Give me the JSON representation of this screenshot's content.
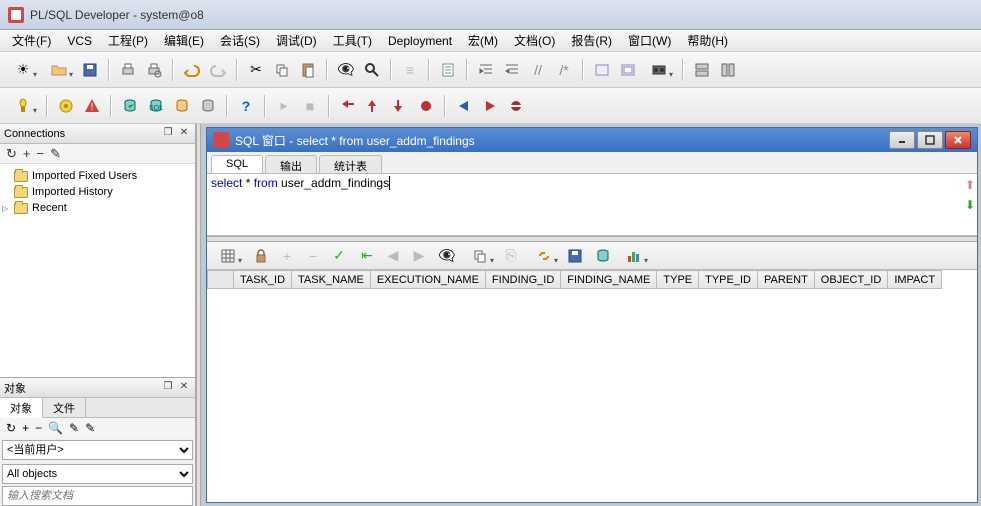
{
  "app": {
    "title": "PL/SQL Developer - system@o8"
  },
  "menu": {
    "file": "文件(F)",
    "vcs": "VCS",
    "project": "工程(P)",
    "edit": "编辑(E)",
    "session": "会话(S)",
    "debug": "调试(D)",
    "tools": "工具(T)",
    "deployment": "Deployment",
    "macro": "宏(M)",
    "document": "文档(O)",
    "report": "报告(R)",
    "window": "窗口(W)",
    "help": "帮助(H)"
  },
  "panels": {
    "connections": {
      "title": "Connections",
      "items": [
        {
          "label": "Imported Fixed Users",
          "exp": false
        },
        {
          "label": "Imported History",
          "exp": false
        },
        {
          "label": "Recent",
          "exp": true
        }
      ]
    },
    "objects": {
      "title": "对象",
      "tabs": {
        "obj": "对象",
        "file": "文件"
      },
      "user_select": "<当前用户>",
      "filter_select": "All objects",
      "search_placeholder": "输入搜索文档"
    }
  },
  "sqlwin": {
    "title": "SQL 窗口 - select * from user_addm_findings",
    "tabs": {
      "sql": "SQL",
      "output": "输出",
      "stats": "统计表"
    },
    "query_kw1": "select",
    "query_mid": " * ",
    "query_kw2": "from",
    "query_tbl": " user_addm_findings",
    "columns": [
      "TASK_ID",
      "TASK_NAME",
      "EXECUTION_NAME",
      "FINDING_ID",
      "FINDING_NAME",
      "TYPE",
      "TYPE_ID",
      "PARENT",
      "OBJECT_ID",
      "IMPACT"
    ]
  }
}
